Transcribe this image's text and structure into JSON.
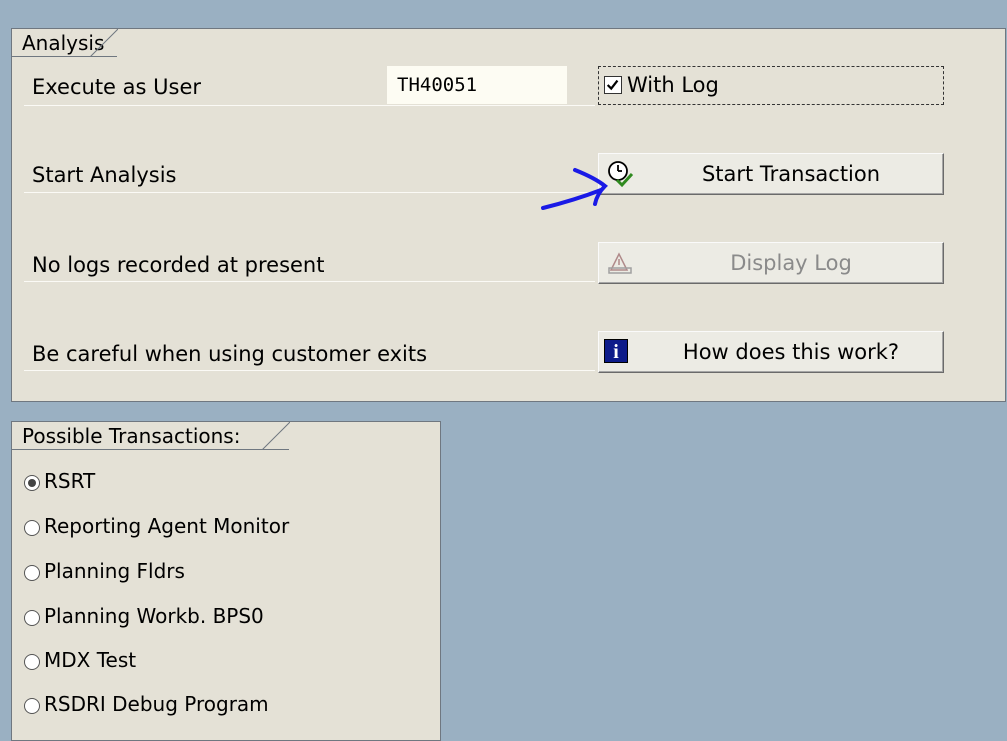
{
  "analysis": {
    "title": "Analysis",
    "execute_label": "Execute as User",
    "user_value": "TH40051",
    "with_log_label": "With Log",
    "with_log_checked": true,
    "start_analysis_label": "Start Analysis",
    "start_button_label": "Start Transaction",
    "logs_label": "No logs recorded at present",
    "display_log_label": "Display Log",
    "careful_label": "Be careful when using customer exits",
    "how_label": "How does this work?"
  },
  "transactions": {
    "title": "Possible Transactions:",
    "options": [
      {
        "label": "RSRT",
        "selected": true
      },
      {
        "label": "Reporting Agent Monitor",
        "selected": false
      },
      {
        "label": "Planning Fldrs",
        "selected": false
      },
      {
        "label": "Planning Workb. BPS0",
        "selected": false
      },
      {
        "label": "MDX Test",
        "selected": false
      },
      {
        "label": "RSDRI Debug Program",
        "selected": false
      }
    ]
  },
  "icons": {
    "start": "clock-check-icon",
    "display_log": "log-icon",
    "how": "info-icon",
    "annotation": "blue-arrow-icon"
  },
  "colors": {
    "background": "#9ab0c2",
    "panel": "#e4e1d6",
    "info_icon": "#0d1b8a",
    "annotation": "#1a1ae6"
  }
}
